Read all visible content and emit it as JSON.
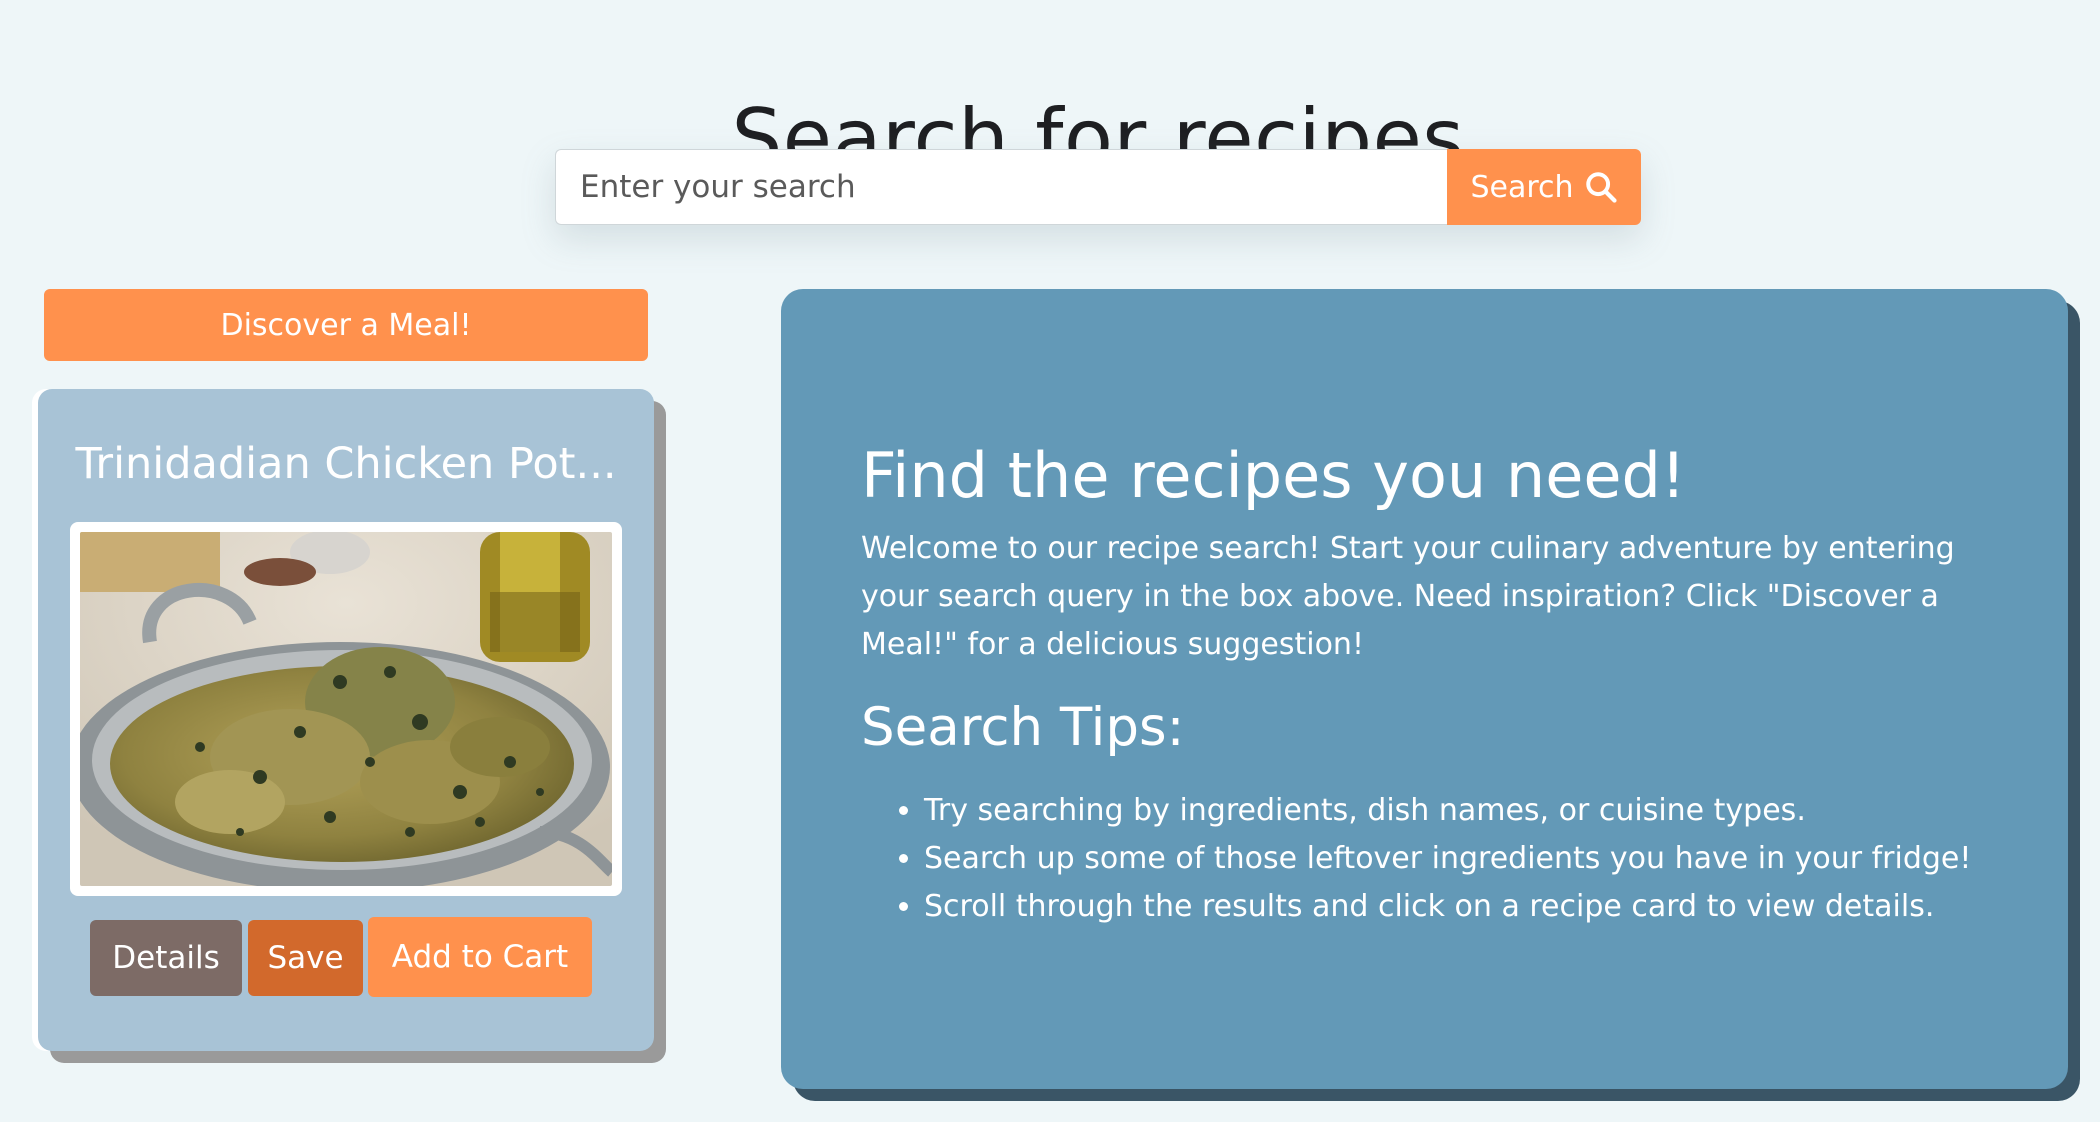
{
  "header": {
    "title": "Search for recipes"
  },
  "search": {
    "placeholder": "Enter your search",
    "value": "",
    "button_label": "Search",
    "button_icon": "search-icon"
  },
  "sidebar": {
    "discover_label": "Discover a Meal!",
    "recipe_card": {
      "title": "Trinidadian Chicken Pot...",
      "image_alt": "curry chicken in a metal pan",
      "actions": {
        "details_label": "Details",
        "save_label": "Save",
        "cart_label": "Add to Cart"
      }
    }
  },
  "info": {
    "heading": "Find the recipes you need!",
    "intro": "Welcome to our recipe search! Start your culinary adventure by entering your search query in the box above. Need inspiration? Click \"Discover a Meal!\" for a delicious suggestion!",
    "tips_heading": "Search Tips:",
    "tips": [
      "Try searching by ingredients, dish names, or cuisine types.",
      "Search up some of those leftover ingredients you have in your fridge!",
      "Scroll through the results and click on a recipe card to view details."
    ]
  },
  "colors": {
    "background": "#eef6f8",
    "accent": "#ff914d",
    "card": "#a8c3d6",
    "panel": "#6399b7",
    "details_button": "#7d6b66",
    "save_button": "#d2692c"
  }
}
